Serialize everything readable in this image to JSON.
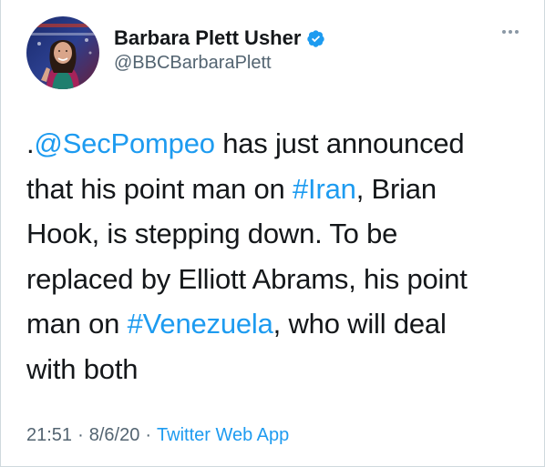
{
  "author": {
    "display_name": "Barbara Plett Usher",
    "handle": "@BBCBarbaraPlett",
    "verified": true,
    "avatar_icon": "profile-photo"
  },
  "tweet": {
    "lines": [
      [
        {
          "text": ".",
          "link": false
        },
        {
          "text": "@SecPompeo",
          "link": true
        },
        {
          "text": " has just announced",
          "link": false
        }
      ],
      [
        {
          "text": "that his point man on ",
          "link": false
        },
        {
          "text": "#Iran",
          "link": true
        },
        {
          "text": ", Brian",
          "link": false
        }
      ],
      [
        {
          "text": "Hook, is stepping down. To be",
          "link": false
        }
      ],
      [
        {
          "text": "replaced by Elliott Abrams, his point",
          "link": false
        }
      ],
      [
        {
          "text": "man on ",
          "link": false
        },
        {
          "text": "#Venezuela",
          "link": true
        },
        {
          "text": ", who will deal",
          "link": false
        }
      ],
      [
        {
          "text": "with both",
          "link": false
        }
      ]
    ]
  },
  "meta": {
    "time": "21:51",
    "date": "8/6/20",
    "separator": "·",
    "source": "Twitter Web App"
  },
  "colors": {
    "link": "#1d9bf0",
    "verified": "#1d9bf0",
    "text": "#14171a",
    "secondary": "#536471"
  },
  "icons": {
    "more": "more-options-icon",
    "verified": "verified-badge-icon"
  }
}
